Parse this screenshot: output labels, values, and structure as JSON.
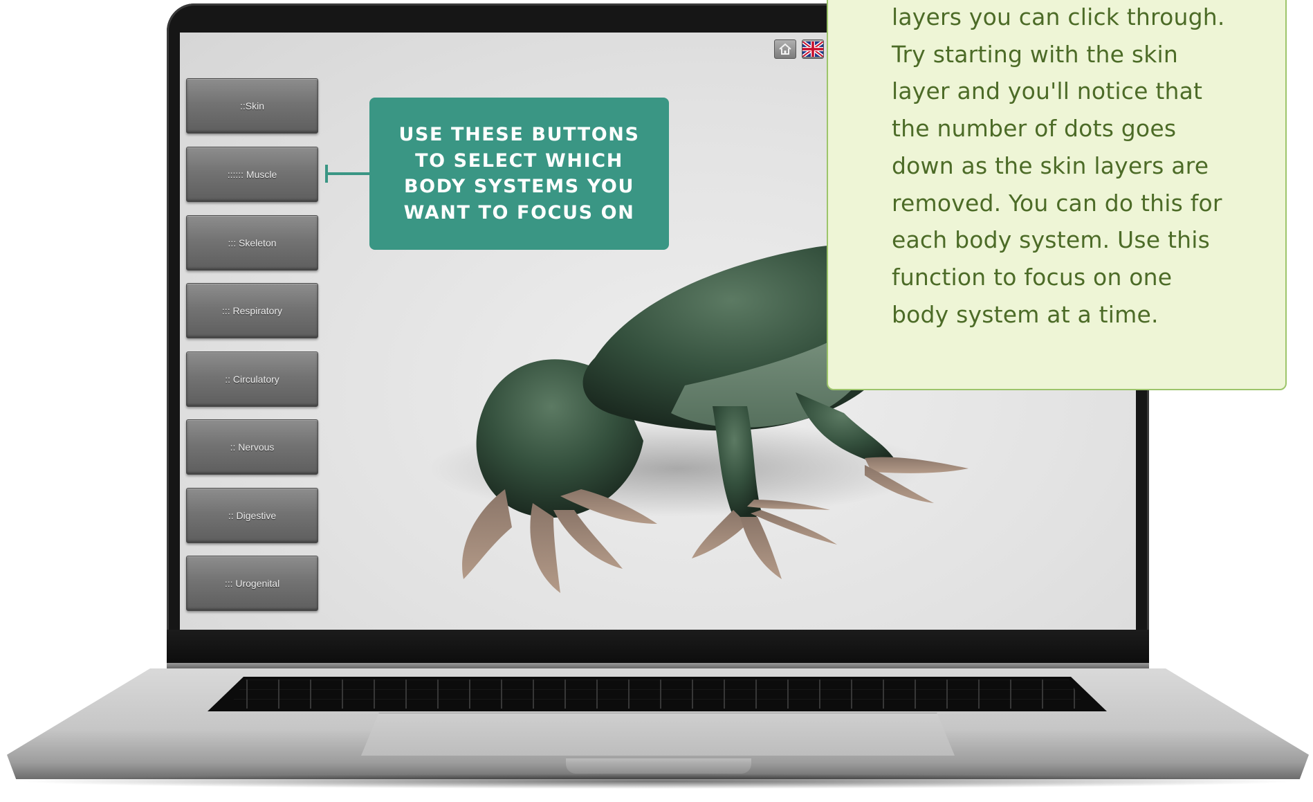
{
  "body_systems": {
    "buttons": [
      {
        "label": "::Skin"
      },
      {
        "label": ":::::: Muscle"
      },
      {
        "label": "::: Skeleton"
      },
      {
        "label": "::: Respiratory"
      },
      {
        "label": ":: Circulatory"
      },
      {
        "label": ":: Nervous"
      },
      {
        "label": ":: Digestive"
      },
      {
        "label": "::: Urogenital"
      }
    ]
  },
  "toolbar": {
    "icons": [
      "home-icon",
      "uk-flag-icon"
    ]
  },
  "callout": {
    "lines": [
      "USE THESE BUTTONS",
      "TO SELECT WHICH",
      "BODY SYSTEMS YOU",
      "WANT TO FOCUS ON"
    ]
  },
  "info_box": {
    "lines": [
      "layers you can click through.",
      "Try starting with the skin",
      "layer and you'll notice that",
      "the number of dots goes",
      "down as the skin layers are",
      "removed. You can do this for",
      "each body system. Use this",
      "function to focus on one",
      "body system at a time."
    ]
  },
  "colors": {
    "callout_bg": "#3a9684",
    "info_bg": "#eef5d6",
    "info_border": "#9cc46a",
    "info_text": "#4c6b27"
  }
}
